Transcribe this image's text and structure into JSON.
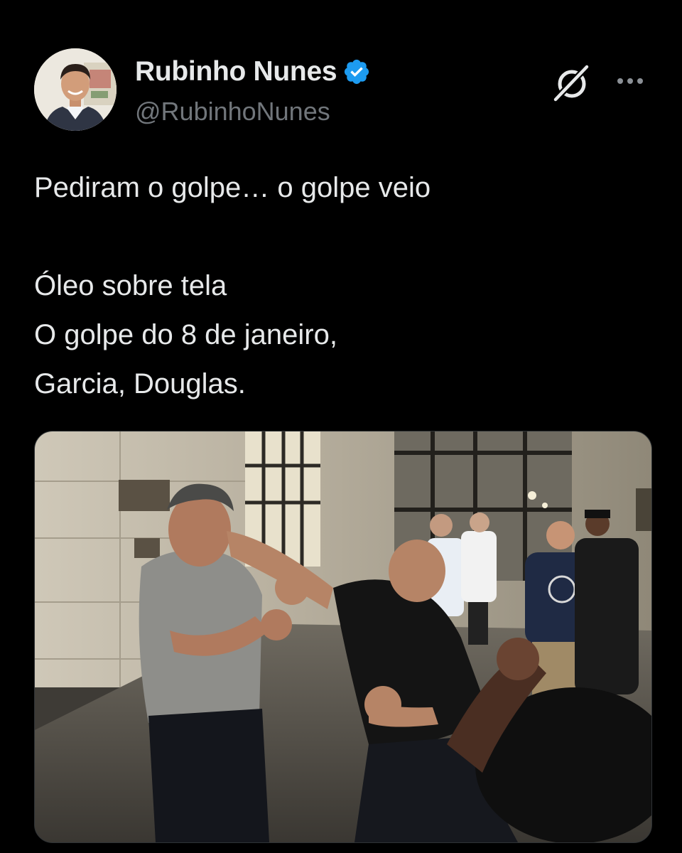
{
  "author": {
    "display_name": "Rubinho Nunes",
    "handle": "@RubinhoNunes",
    "verified": true,
    "verified_color": "#1d9bf0"
  },
  "post": {
    "lines": [
      "Pediram o golpe… o golpe veio",
      "",
      "Óleo sobre tela",
      "O golpe do 8 de janeiro,",
      "Garcia, Douglas."
    ]
  },
  "icons": {
    "grok": "grok-icon",
    "more": "more-options-icon",
    "verified": "verified-badge-icon"
  },
  "theme": {
    "background": "#000000",
    "text": "#e7e9ea",
    "secondary_text": "#71767b"
  }
}
